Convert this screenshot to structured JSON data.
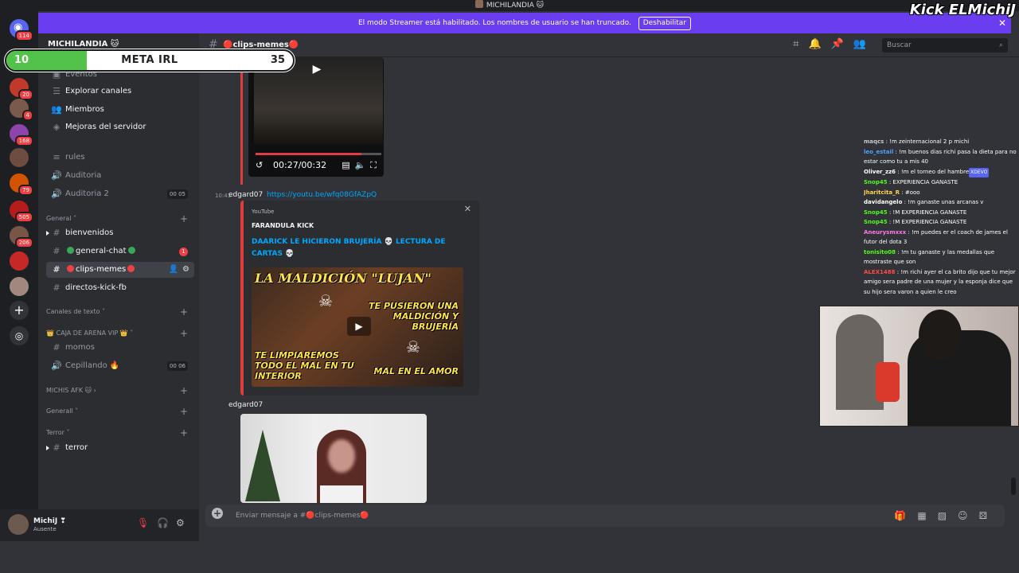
{
  "window": {
    "title": "MICHILANDIA 🐱"
  },
  "banner": {
    "text": "El modo Streamer está habilitado. Los nombres de usuario se han truncado.",
    "button": "Deshabilitar",
    "close": "✕"
  },
  "overlay": {
    "kick_logo": "Kick ELMichiJ",
    "meta": {
      "current": "10",
      "title": "META IRL",
      "goal": "35",
      "progress": 0.28
    }
  },
  "servers": {
    "items": [
      {
        "badge": "114",
        "color": "#5865f2"
      },
      {
        "badge": "20",
        "color": "#c0392b"
      },
      {
        "badge": "4",
        "color": "#7a5a4a"
      },
      {
        "badge": "168",
        "color": "#8e44ad"
      },
      {
        "badge": "",
        "color": "#6d4c41"
      },
      {
        "badge": "79",
        "color": "#d35400"
      },
      {
        "badge": "505",
        "color": "#b71c1c"
      },
      {
        "badge": "206",
        "color": "#795548"
      },
      {
        "badge": "",
        "color": "#c62828"
      },
      {
        "badge": "",
        "color": "#a1887f"
      }
    ],
    "add": "+",
    "discover": "◎"
  },
  "sidebar": {
    "server_name": "MICHILANDIA 🐱",
    "top_links": [
      "Eventos",
      "Explorar canales",
      "Miembros",
      "Mejoras del servidor"
    ],
    "top_channels": [
      {
        "icon": "≡",
        "name": "rules"
      },
      {
        "icon": "🔊",
        "name": "Auditoria",
        "counts": ""
      },
      {
        "icon": "🔊",
        "name": "Auditoria 2",
        "counts": "00 05"
      }
    ],
    "cat_general": "General",
    "channels_general": [
      {
        "name": "bienvenidos",
        "badge": ""
      },
      {
        "name": "general-chat",
        "badge": "1"
      },
      {
        "name": "clips-memes",
        "badge": ""
      },
      {
        "name": "directos-kick-fb",
        "badge": ""
      }
    ],
    "cat_texto": "Canales de texto",
    "cat_vip": "👑 CAJA DE ARENA VIP 👑",
    "vip_channels": [
      {
        "name": "momos",
        "counts": ""
      },
      {
        "name": "Cepillando 🔥",
        "counts": "00 06"
      }
    ],
    "cat_afk": "MICHIS AFK 🐱",
    "cat_generall": "Generall",
    "cat_terror": "Terror",
    "terror_channels": [
      {
        "name": "terror"
      }
    ]
  },
  "user": {
    "name": "MichiJ ❣",
    "status": "Ausente"
  },
  "header": {
    "channel": "🔴clips-memes🔴",
    "search_placeholder": "Buscar"
  },
  "messages": {
    "video": {
      "time": "00:27/00:32",
      "progress": 0.84
    },
    "msg1": {
      "time": "10:41",
      "author": "edgard07",
      "link": "https://youtu.be/wfq08GfAZpQ",
      "embed": {
        "provider": "YouTube",
        "author": "FARANDULA KICK",
        "title": "DAARICK LE HICIERON BRUJERÍA 💀 LECTURA DE CARTAS 💀",
        "thumb_text1": "LA MALDICIÓN \"LUJAN\"",
        "thumb_text2": "TE PUSIERON UNA MALDICIÓN Y BRUJERÍA",
        "thumb_text3": "TE LIMPIAREMOS TODO EL MAL EN TU INTERIOR",
        "thumb_text4": "MAL EN EL AMOR"
      }
    },
    "msg2": {
      "author": "edgard07"
    }
  },
  "composer": {
    "placeholder": "Enviar mensaje a #🔴clips-memes🔴"
  },
  "stream_chat": [
    {
      "user": "maqcs",
      "text": ": !m zeinternacional 2 p michi",
      "color": "#c9c9c9"
    },
    {
      "user": "leo_estail",
      "text": ": !m buenos dias richi pasa la dieta para no estar como tu a mis 40",
      "color": "#4aa3ff"
    },
    {
      "user": "Oliver_zz6",
      "text": ": !m el torneo del hambre",
      "color": "#fff",
      "tag": "XDEVO"
    },
    {
      "user": "Snop45",
      "text": ": EXPERIENCIA GANASTE",
      "color": "#53fc18"
    },
    {
      "user": "Jharitcita_R",
      "text": ": #ooo",
      "color": "#ffd54a"
    },
    {
      "user": "davidangelo",
      "text": ": !m ganaste unas arcanas v",
      "color": "#fff"
    },
    {
      "user": "Snop45",
      "text": ": !M EXPERIENCIA GANASTE",
      "color": "#53fc18"
    },
    {
      "user": "Snop45",
      "text": ": !M EXPERIENCIA GANASTE",
      "color": "#53fc18"
    },
    {
      "user": "Aneurysmxxx",
      "text": ": !m puedes er el coach de james el futor del dota 3",
      "color": "#ff7ae0"
    },
    {
      "user": "tonisito08",
      "text": ": !m tu ganaste y las medallas que mostraste que son",
      "color": "#53fc18"
    },
    {
      "user": "ALEX1488",
      "text": ": !m richi ayer el ca brito dijo que tu mejor amigo sera padre de una mujer y la esponja dice que su hijo sera varon a quien le creo",
      "color": "#ff4a4a"
    }
  ]
}
